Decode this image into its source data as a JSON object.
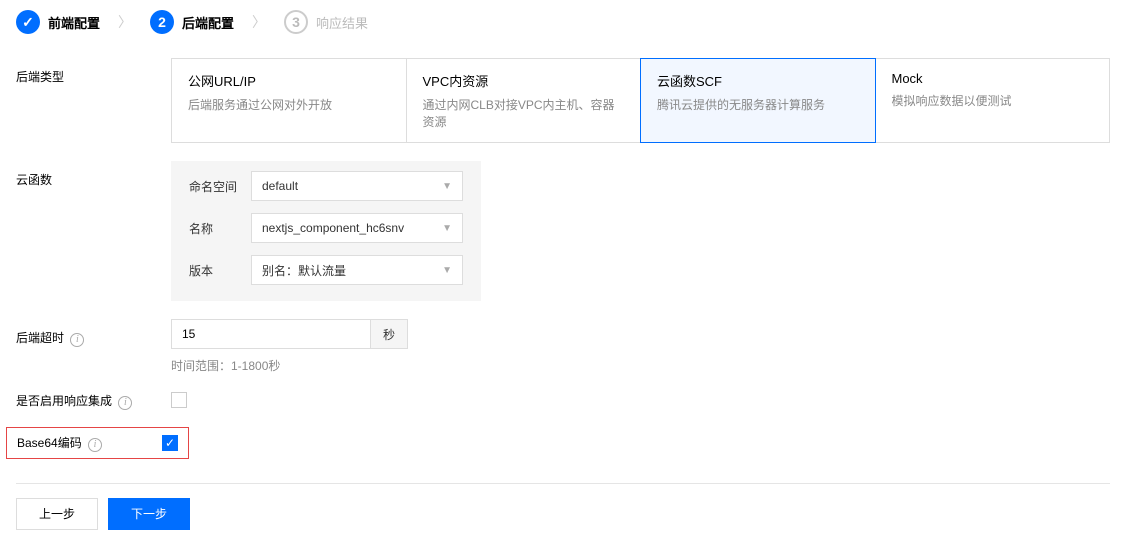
{
  "steps": [
    {
      "label": "前端配置",
      "state": "done"
    },
    {
      "label": "后端配置",
      "state": "active",
      "num": "2"
    },
    {
      "label": "响应结果",
      "state": "pending",
      "num": "3"
    }
  ],
  "labels": {
    "backend_type": "后端类型",
    "scf": "云函数",
    "timeout": "后端超时",
    "response_integration": "是否启用响应集成",
    "base64": "Base64编码"
  },
  "backend_types": [
    {
      "title": "公网URL/IP",
      "desc": "后端服务通过公网对外开放"
    },
    {
      "title": "VPC内资源",
      "desc": "通过内网CLB对接VPC内主机、容器资源"
    },
    {
      "title": "云函数SCF",
      "desc": "腾讯云提供的无服务器计算服务",
      "selected": true
    },
    {
      "title": "Mock",
      "desc": "模拟响应数据以便测试"
    }
  ],
  "scf": {
    "namespace_label": "命名空间",
    "namespace_value": "default",
    "name_label": "名称",
    "name_value": "nextjs_component_hc6snv",
    "version_label": "版本",
    "version_value": "别名：默认流量"
  },
  "timeout": {
    "value": "15",
    "unit": "秒",
    "hint": "时间范围：1-1800秒"
  },
  "response_integration_checked": false,
  "base64_checked": true,
  "footer": {
    "prev": "上一步",
    "next": "下一步"
  }
}
